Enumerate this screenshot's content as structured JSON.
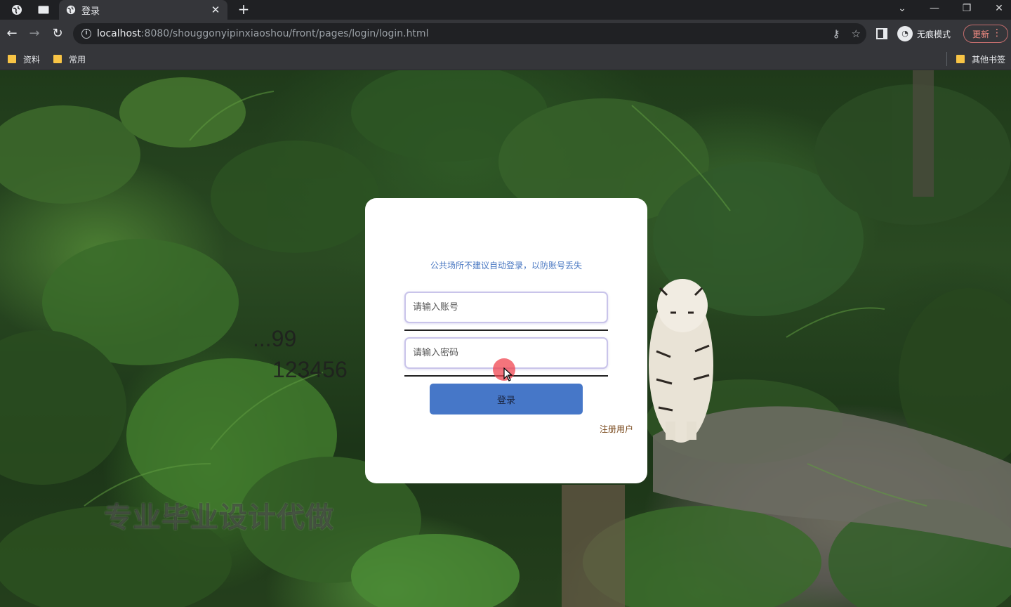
{
  "browser": {
    "tab_title": "登录",
    "new_tab": "+",
    "url_host": "localhost",
    "url_rest": ":8080/shouggonyipinxiaoshou/front/pages/login/login.html",
    "profile_label": "无痕模式",
    "update_label": "更新",
    "window_controls": {
      "minimize": "—",
      "restore": "❐",
      "close": "✕",
      "dropdown": "⌄"
    }
  },
  "bookmarks": {
    "items": [
      {
        "label": "资料"
      },
      {
        "label": "常用"
      }
    ],
    "other": "其他书签"
  },
  "page": {
    "watermark": "专业毕业设计代做",
    "overlay_username": "...99",
    "overlay_password": "123456"
  },
  "login": {
    "hint": "公共场所不建议自动登录，以防账号丢失",
    "username_placeholder": "请输入账号",
    "password_placeholder": "请输入密码",
    "submit_label": "登录",
    "register_label": "注册用户"
  },
  "colors": {
    "accent": "#4677c8",
    "hint": "#4a78c2",
    "register": "#7a4a1e",
    "field_border": "#c9c4ea"
  }
}
